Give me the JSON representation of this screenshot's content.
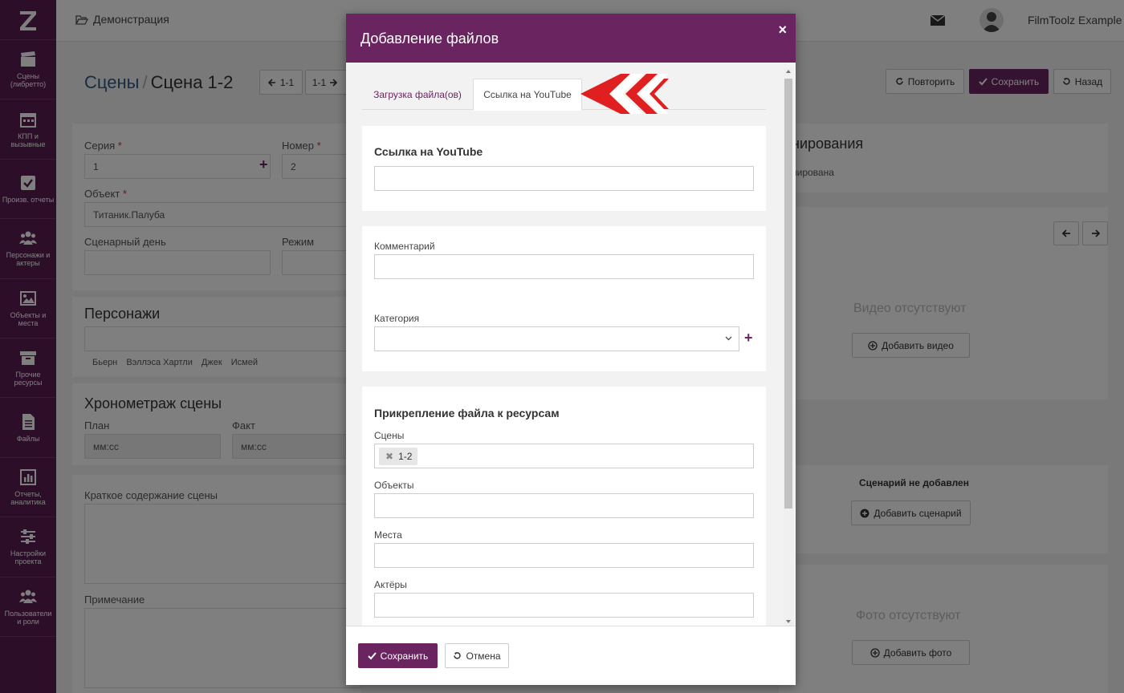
{
  "app": {
    "logo": "Z",
    "breadcrumb": "Демонстрация",
    "user_name": "FilmToolz Example"
  },
  "sidebar": {
    "items": [
      {
        "icon": "clapperboard-icon",
        "label": "Сцены (либретто)"
      },
      {
        "icon": "calendar-icon",
        "label": "КПП и вызывные"
      },
      {
        "icon": "checkbox-icon",
        "label": "Произв. отчеты"
      },
      {
        "icon": "users-icon",
        "label": "Персонажи и актеры"
      },
      {
        "icon": "image-icon",
        "label": "Объекты и места"
      },
      {
        "icon": "archive-icon",
        "label": "Прочие ресурсы"
      },
      {
        "icon": "file-icon",
        "label": "Файлы"
      },
      {
        "icon": "bar-chart-icon",
        "label": "Отчеты, аналитика"
      },
      {
        "icon": "sliders-icon",
        "label": "Настройки проекта"
      },
      {
        "icon": "users-icon",
        "label": "Пользователи и роли"
      }
    ]
  },
  "page": {
    "title_root": "Сцены",
    "title_sep": "/",
    "title_current": "Сцена 1-2",
    "prev_label": "1-1",
    "next_label": "1-1",
    "repeat_label": "Повторить",
    "save_label": "Сохранить",
    "back_label": "Назад",
    "series_label": "Серия",
    "series_value": "1",
    "number_label": "Номер",
    "number_value": "2",
    "object_label": "Объект",
    "object_value": "Титаник.Палуба",
    "script_day_label": "Сценарный день",
    "mode_label": "Режим",
    "characters_title": "Персонажи",
    "characters": [
      "Бьерн",
      "Вэллэса Хартли",
      "Джек",
      "Исмей"
    ],
    "timing_title": "Хронометраж сцены",
    "plan_label": "План",
    "fact_label": "Факт",
    "time_placeholder": "мм:сс",
    "summary_label": "Краткое содержание сцены",
    "note_label": "Примечание",
    "planning_title_fragment": "нирования",
    "planning_status_fragment": "нирована",
    "no_video": "Видео отсутствуют",
    "add_video": "Добавить видео",
    "no_script": "Сценарий не добавлен",
    "add_script": "Добавить сценарий",
    "no_photo": "Фото отсутствуют",
    "add_photo": "Добавить фото"
  },
  "modal": {
    "title": "Добавление файлов",
    "close": "×",
    "tabs": [
      {
        "label": "Загрузка файла(ов)",
        "active": false
      },
      {
        "label": "Ссылка на YouTube",
        "active": true
      }
    ],
    "youtube_title": "Ссылка на YouTube",
    "youtube_value": "",
    "comment_label": "Комментарий",
    "comment_value": "",
    "category_label": "Категория",
    "category_value": "",
    "attach_title": "Прикрепление файла к ресурсам",
    "scenes_label": "Сцены",
    "scenes_chips": [
      "1-2"
    ],
    "objects_label": "Объекты",
    "places_label": "Места",
    "actors_label": "Актёры",
    "save_label": "Сохранить",
    "cancel_label": "Отмена"
  },
  "colors": {
    "brand": "#6a2460",
    "sidebar": "#5a1d52",
    "arrow_accent": "#e02020"
  }
}
